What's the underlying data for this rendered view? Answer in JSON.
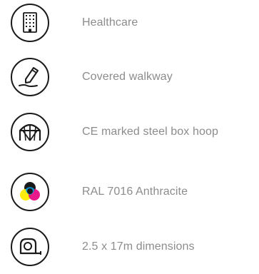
{
  "features": [
    {
      "label": "Healthcare",
      "icon": "hospital-building-icon"
    },
    {
      "label": "Covered walkway",
      "icon": "pen-icon"
    },
    {
      "label": "CE marked steel box hoop",
      "icon": "hoop-structure-icon"
    },
    {
      "label": "RAL 7016 Anthracite",
      "icon": "color-mix-icon"
    },
    {
      "label": "2.5  x 17m dimensions",
      "icon": "tape-measure-icon"
    }
  ],
  "colors": {
    "icon_stroke": "#1a1a1a",
    "label_text": "#8c8c8c",
    "cmy_cyan": "#00a0e3",
    "cmy_magenta": "#e5007e",
    "cmy_yellow": "#ffed00"
  }
}
